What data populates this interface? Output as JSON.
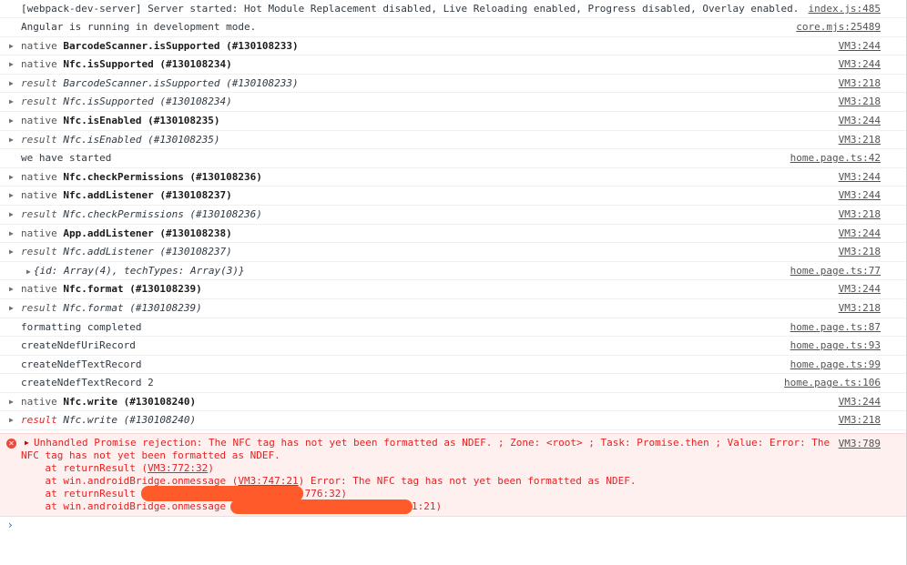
{
  "log": [
    {
      "kind": "plain",
      "text": "[webpack-dev-server] Server started: Hot Module Replacement disabled, Live Reloading enabled, Progress disabled, Overlay enabled.",
      "src": "index.js:485"
    },
    {
      "kind": "plain",
      "text": "Angular is running in development mode.",
      "src": "core.mjs:25489"
    },
    {
      "kind": "native",
      "prefix": "native ",
      "method": "BarcodeScanner.isSupported",
      "id": " (#130108233)",
      "src": "VM3:244"
    },
    {
      "kind": "native",
      "prefix": "native ",
      "method": "Nfc.isSupported",
      "id": " (#130108234)",
      "src": "VM3:244"
    },
    {
      "kind": "result",
      "prefix": "result ",
      "method": "BarcodeScanner.isSupported",
      "id": " (#130108233)",
      "src": "VM3:218"
    },
    {
      "kind": "result",
      "prefix": "result ",
      "method": "Nfc.isSupported",
      "id": " (#130108234)",
      "src": "VM3:218"
    },
    {
      "kind": "native",
      "prefix": "native ",
      "method": "Nfc.isEnabled",
      "id": " (#130108235)",
      "src": "VM3:244"
    },
    {
      "kind": "result",
      "prefix": "result ",
      "method": "Nfc.isEnabled",
      "id": " (#130108235)",
      "src": "VM3:218"
    },
    {
      "kind": "plain",
      "text": "we have started",
      "src": "home.page.ts:42"
    },
    {
      "kind": "native",
      "prefix": "native ",
      "method": "Nfc.checkPermissions",
      "id": " (#130108236)",
      "src": "VM3:244"
    },
    {
      "kind": "native",
      "prefix": "native ",
      "method": "Nfc.addListener",
      "id": " (#130108237)",
      "src": "VM3:244"
    },
    {
      "kind": "result",
      "prefix": "result ",
      "method": "Nfc.checkPermissions",
      "id": " (#130108236)",
      "src": "VM3:218"
    },
    {
      "kind": "native",
      "prefix": "native ",
      "method": "App.addListener",
      "id": " (#130108238)",
      "src": "VM3:244"
    },
    {
      "kind": "result",
      "prefix": "result ",
      "method": "Nfc.addListener",
      "id": " (#130108237)",
      "src": "VM3:218"
    },
    {
      "kind": "object",
      "text": "{id: Array(4), techTypes: Array(3)}",
      "src": "home.page.ts:77"
    },
    {
      "kind": "native",
      "prefix": "native ",
      "method": "Nfc.format",
      "id": " (#130108239)",
      "src": "VM3:244"
    },
    {
      "kind": "result",
      "prefix": "result ",
      "method": "Nfc.format",
      "id": " (#130108239)",
      "src": "VM3:218"
    },
    {
      "kind": "plain",
      "text": "formatting completed",
      "src": "home.page.ts:87"
    },
    {
      "kind": "plain",
      "text": "createNdefUriRecord",
      "src": "home.page.ts:93"
    },
    {
      "kind": "plain",
      "text": "createNdefTextRecord",
      "src": "home.page.ts:99"
    },
    {
      "kind": "plain",
      "text": "createNdefTextRecord 2",
      "src": "home.page.ts:106"
    },
    {
      "kind": "native",
      "prefix": "native ",
      "method": "Nfc.write",
      "id": " (#130108240)",
      "src": "VM3:244"
    },
    {
      "kind": "result-red",
      "prefix": "result ",
      "method": "Nfc.write",
      "id": " (#130108240)",
      "src": "VM3:218"
    }
  ],
  "error": {
    "line1": "Unhandled Promise rejection: The NFC tag has not yet been formatted as NDEF. ; Zone: <root> ; Task: Promise.then ; Value: Error: The",
    "line2": "NFC tag has not yet been formatted as NDEF.",
    "l3_pre": "    at returnResult (",
    "l3_link": "VM3:772:32",
    "l3_post": ")",
    "l4_pre": "    at win.androidBridge.onmessage (",
    "l4_link": "VM3:747:21",
    "l4_post": ") Error: The NFC tag has not yet been formatted as NDEF.",
    "l5_pre": "    at returnResult",
    "l5_tail": ":776:32)",
    "l6_pre": "    at win.androidBridge.onmessage",
    "l6_tail": "1:21)",
    "src": "VM3:789"
  },
  "prompt": "›"
}
